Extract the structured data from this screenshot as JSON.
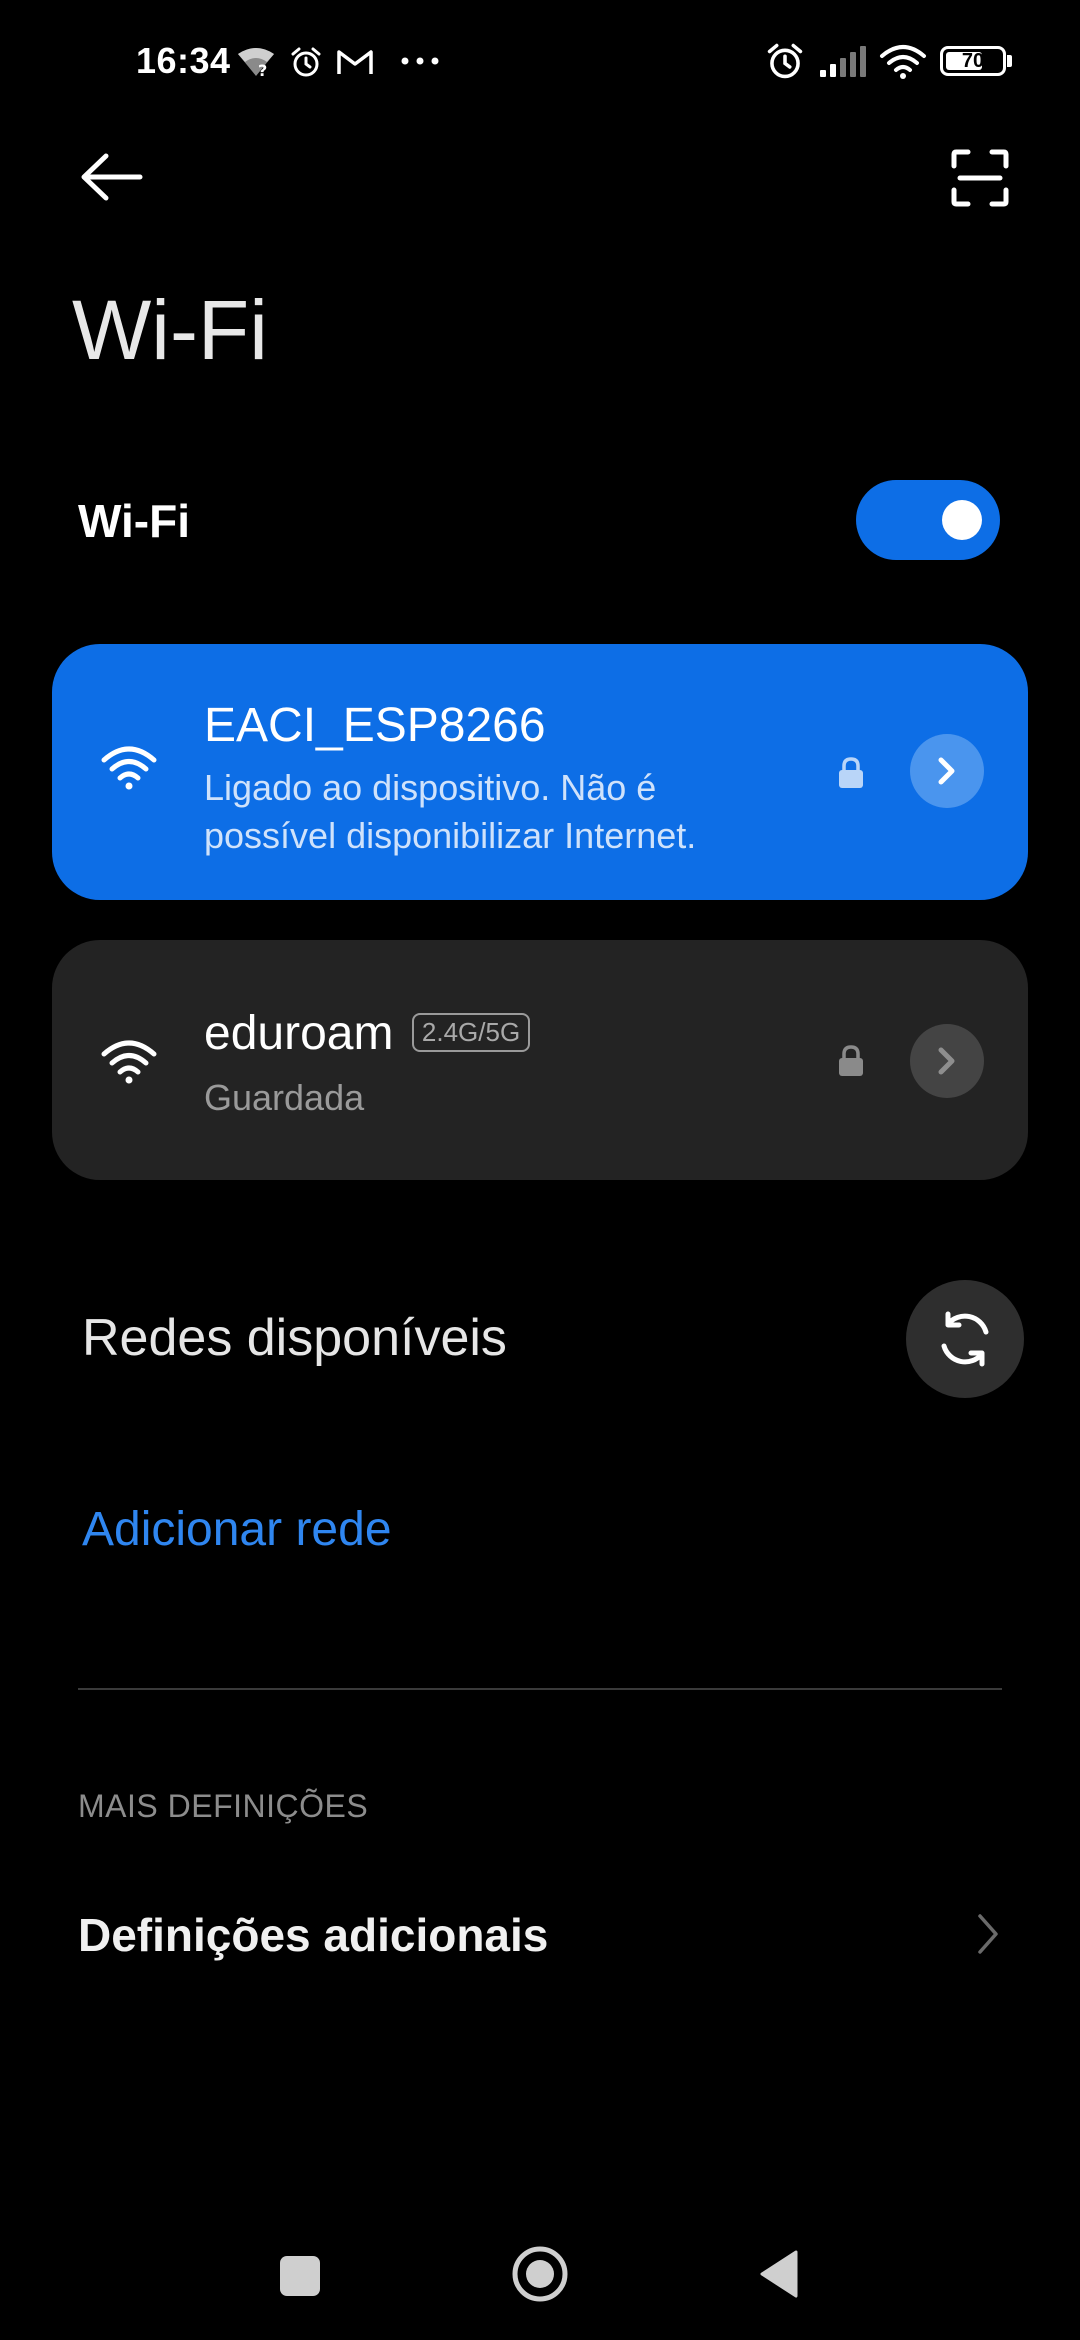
{
  "status_bar": {
    "time": "16:34",
    "battery": "70",
    "battery_level": 0.7,
    "left_icons": [
      "wifi-question-icon",
      "alarm-icon",
      "gmail-icon",
      "more-dots-icon"
    ],
    "right_icons": [
      "alarm-icon",
      "cellular-signal-icon",
      "wifi-icon",
      "battery-icon"
    ]
  },
  "header": {
    "title": "Wi-Fi",
    "back_icon": "arrow-left-icon",
    "scan_icon": "qr-scan-icon"
  },
  "wifi_toggle": {
    "label": "Wi-Fi",
    "enabled": true
  },
  "networks": [
    {
      "name": "EACI_ESP8266",
      "status": "Ligado ao dispositivo. Não é possível disponibilizar Internet.",
      "status_line1": "Ligado ao dispositivo. Não é",
      "status_line2": "possível disponibilizar Internet.",
      "secured": true,
      "connected": true
    },
    {
      "name": "eduroam",
      "band": "2.4G/5G",
      "status": "Guardada",
      "secured": true,
      "connected": false
    }
  ],
  "available_section": {
    "title": "Redes disponíveis",
    "refresh_icon": "refresh-icon"
  },
  "add_network": "Adicionar rede",
  "more_settings": {
    "header": "MAIS DEFINIÇÕES",
    "item": "Definições adicionais"
  },
  "colors": {
    "accent": "#0d6ee6",
    "link": "#2f86f0",
    "card_dark": "#232323",
    "background": "#000000"
  },
  "nav_bar": [
    "recents-square-icon",
    "home-circle-icon",
    "back-triangle-icon"
  ]
}
